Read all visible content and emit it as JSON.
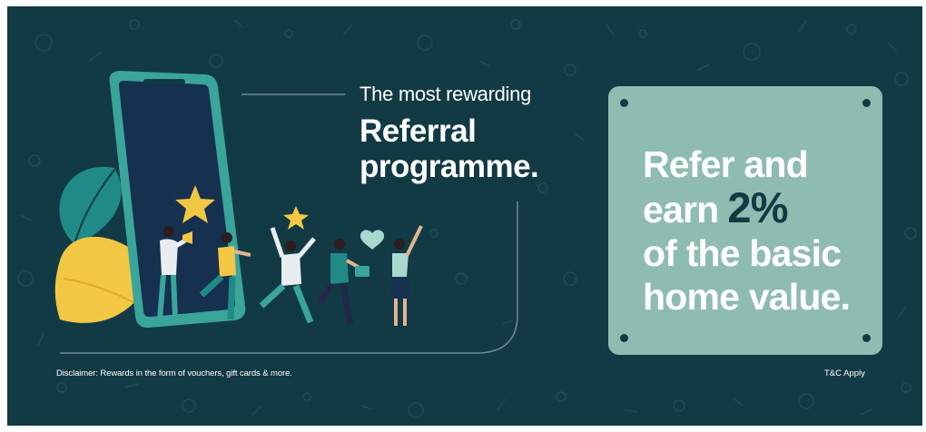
{
  "banner": {
    "tagline": "The most rewarding",
    "headline_line1": "Referral",
    "headline_line2": "programme.",
    "offer": {
      "line1": "Refer and",
      "line2_prefix": "earn",
      "percent": "2%",
      "line3": "of the basic",
      "line4": "home value."
    },
    "disclaimer": "Disclaimer: Rewards in the form of vouchers, gift cards & more.",
    "terms": "T&C Apply"
  },
  "colors": {
    "background": "#123a45",
    "offer_panel": "#8fbcb0",
    "accent_yellow": "#f2c744",
    "accent_teal": "#3aa59a"
  }
}
